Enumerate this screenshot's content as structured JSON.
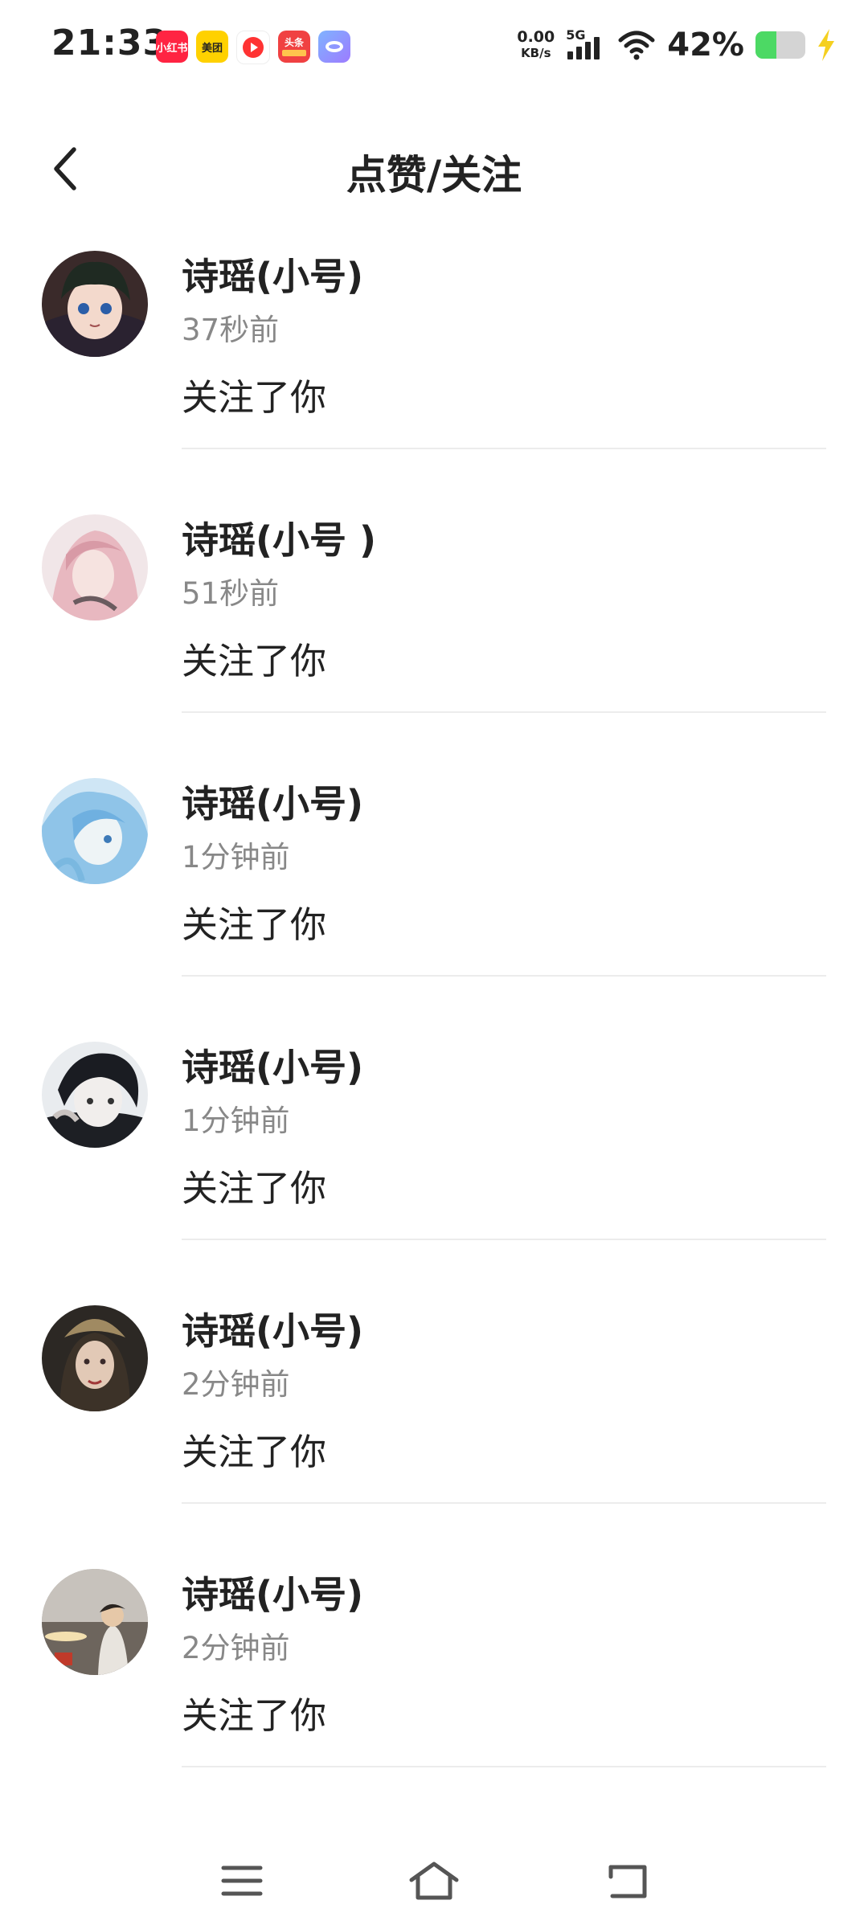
{
  "status_bar": {
    "time": "21:33",
    "app_icons": [
      {
        "name": "xiaohongshu-icon",
        "label": "小红书"
      },
      {
        "name": "meituan-icon",
        "label": "美团"
      },
      {
        "name": "video-play-icon",
        "label": ""
      },
      {
        "name": "toutiao-icon",
        "label": "头条"
      },
      {
        "name": "bubble-app-icon",
        "label": ""
      }
    ],
    "net_speed": "0.00",
    "net_speed_unit": "KB/s",
    "network_type": "5G",
    "battery_percent": "42%",
    "battery_level": 0.42,
    "battery_color": "#4cd964"
  },
  "header": {
    "title": "点赞/关注"
  },
  "notifications": [
    {
      "name": "诗瑶(小号)",
      "time": "37秒前",
      "action": "关注了你"
    },
    {
      "name": "诗瑶(小号 )",
      "time": "51秒前",
      "action": "关注了你"
    },
    {
      "name": "诗瑶(小号)",
      "time": "1分钟前",
      "action": "关注了你"
    },
    {
      "name": "诗瑶(小号)",
      "time": "1分钟前",
      "action": "关注了你"
    },
    {
      "name": "诗瑶(小号)",
      "time": "2分钟前",
      "action": "关注了你"
    },
    {
      "name": "诗瑶(小号)",
      "time": "2分钟前",
      "action": "关注了你"
    }
  ]
}
